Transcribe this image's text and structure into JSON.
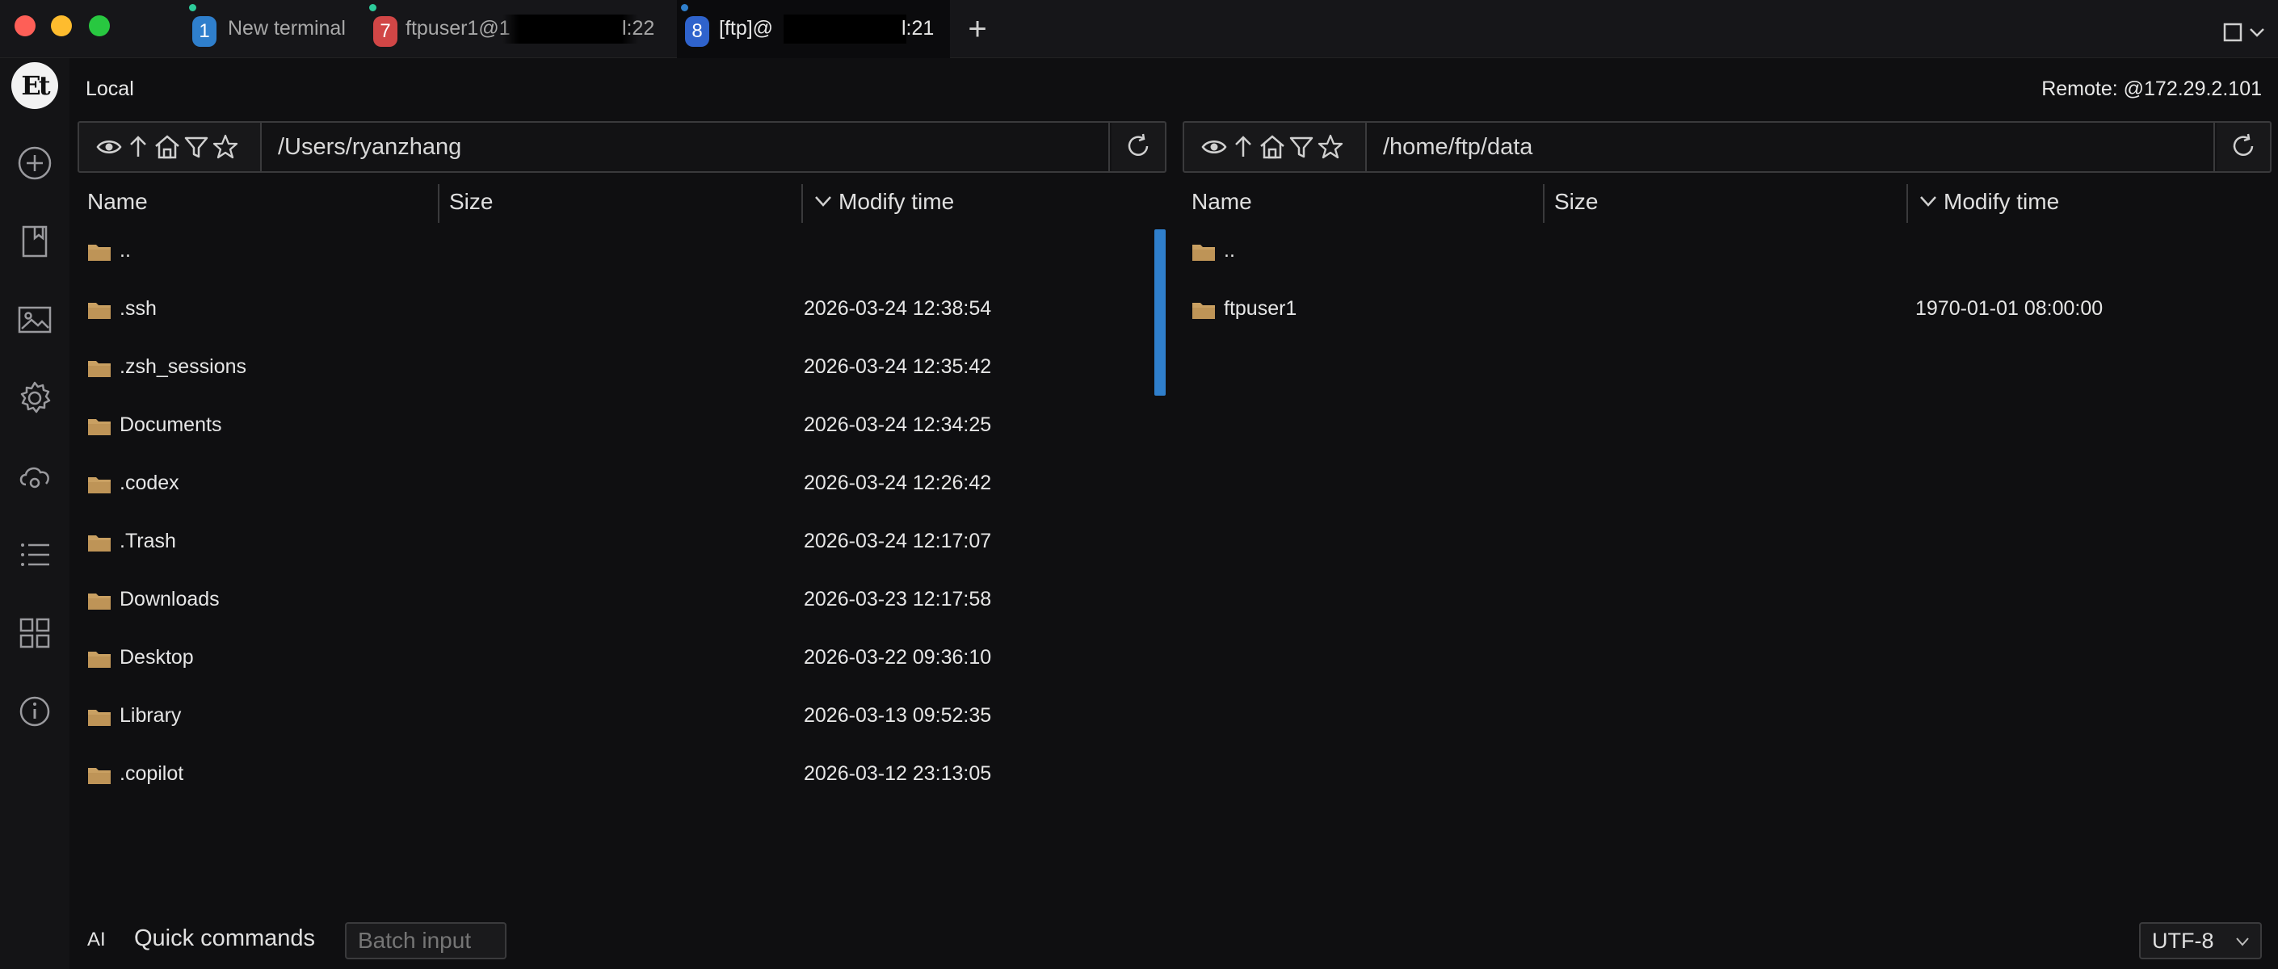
{
  "tabs": [
    {
      "number": "1",
      "title": "New terminal",
      "color": "#2f7fcc",
      "dot_color": "#2dcb9a"
    },
    {
      "number": "7",
      "title_prefix": "ftpuser1@1",
      "title_suffix": "l:22",
      "color": "#d14646",
      "dot_color": "#2dcb9a"
    },
    {
      "number": "8",
      "title_prefix": "[ftp]@",
      "title_suffix": "l:21",
      "color": "#2f63cc",
      "dot_color": "#2f7fcc"
    }
  ],
  "tab_add_label": "+",
  "logo": "Et",
  "rail_icons": [
    "add-icon",
    "bookmark-icon",
    "image-icon",
    "gear-icon",
    "cloud-icon",
    "list-icon",
    "grid-icon",
    "info-icon"
  ],
  "local": {
    "label": "Local",
    "path": "/Users/ryanzhang",
    "columns": {
      "name": "Name",
      "size": "Size",
      "mtime": "Modify time"
    },
    "rows": [
      {
        "name": "..",
        "mtime": ""
      },
      {
        "name": ".ssh",
        "mtime": "2026-03-24 12:38:54"
      },
      {
        "name": ".zsh_sessions",
        "mtime": "2026-03-24 12:35:42"
      },
      {
        "name": "Documents",
        "mtime": "2026-03-24 12:34:25"
      },
      {
        "name": ".codex",
        "mtime": "2026-03-24 12:26:42"
      },
      {
        "name": ".Trash",
        "mtime": "2026-03-24 12:17:07"
      },
      {
        "name": "Downloads",
        "mtime": "2026-03-23 12:17:58"
      },
      {
        "name": "Desktop",
        "mtime": "2026-03-22 09:36:10"
      },
      {
        "name": "Library",
        "mtime": "2026-03-13 09:52:35"
      },
      {
        "name": ".copilot",
        "mtime": "2026-03-12 23:13:05"
      }
    ]
  },
  "remote": {
    "label": "Remote: @172.29.2.101",
    "path": "/home/ftp/data",
    "columns": {
      "name": "Name",
      "size": "Size",
      "mtime": "Modify time"
    },
    "rows": [
      {
        "name": "..",
        "mtime": ""
      },
      {
        "name": "ftpuser1",
        "mtime": "1970-01-01 08:00:00"
      }
    ]
  },
  "footer": {
    "ai_label": "AI",
    "quick_commands": "Quick commands",
    "batch_placeholder": "Batch input",
    "encoding": "UTF-8"
  },
  "colors": {
    "accent": "#2f7fcc",
    "folder": "#c9a062",
    "background": "#0f0f11"
  }
}
